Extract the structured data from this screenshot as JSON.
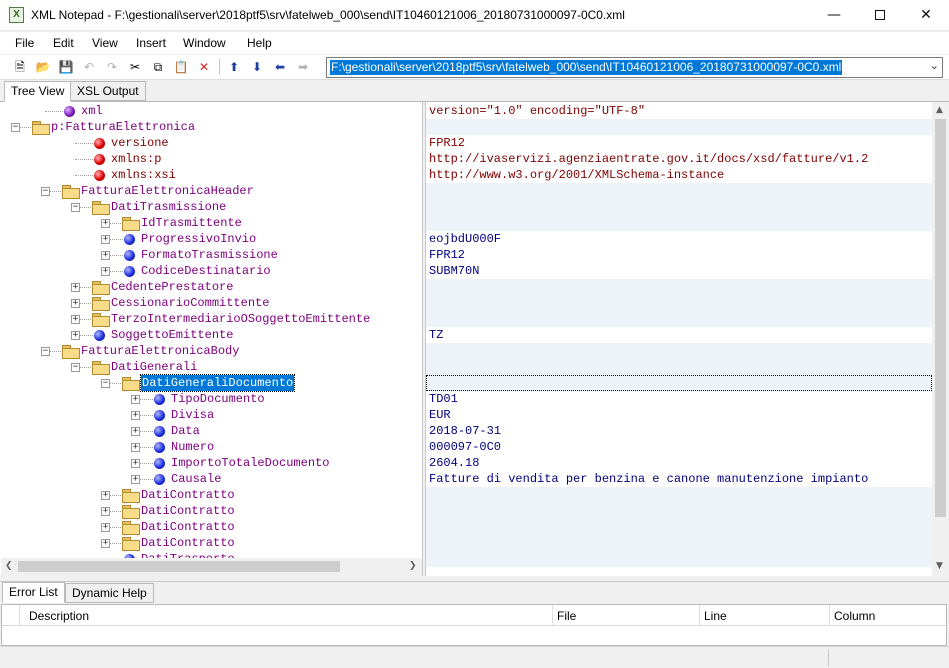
{
  "window": {
    "title": "XML Notepad - F:\\gestionali\\server\\2018ptf5\\srv\\fatelweb_000\\send\\IT10460121006_20180731000097-0C0.xml",
    "app_icon_letter": "X"
  },
  "menu": [
    "File",
    "Edit",
    "View",
    "Insert",
    "Window",
    "Help"
  ],
  "toolbar": {
    "buttons": [
      "new-icon",
      "open-icon",
      "save-icon",
      "undo-icon",
      "redo-icon",
      "cut-icon",
      "copy-icon",
      "paste-icon",
      "delete-icon",
      "nudge-up-icon",
      "nudge-down-icon",
      "nudge-left-icon",
      "nudge-right-icon"
    ],
    "path": "F:\\gestionali\\server\\2018ptf5\\srv\\fatelweb_000\\send\\IT10460121006_20180731000097-0C0.xml"
  },
  "tabs": [
    "Tree View",
    "XSL Output"
  ],
  "tree": [
    {
      "label": "xml",
      "kind": "purple",
      "depth": 1,
      "expander": "",
      "value": "version=\"1.0\" encoding=\"UTF-8\""
    },
    {
      "label": "p:FatturaElettronica",
      "kind": "folder",
      "depth": 0,
      "expander": "−",
      "value": ""
    },
    {
      "label": "versione",
      "kind": "red",
      "depth": 2,
      "expander": "",
      "value": "FPR12"
    },
    {
      "label": "xmlns:p",
      "kind": "red",
      "depth": 2,
      "expander": "",
      "value": "http://ivaservizi.agenziaentrate.gov.it/docs/xsd/fatture/v1.2"
    },
    {
      "label": "xmlns:xsi",
      "kind": "red",
      "depth": 2,
      "expander": "",
      "value": "http://www.w3.org/2001/XMLSchema-instance"
    },
    {
      "label": "FatturaElettronicaHeader",
      "kind": "folder",
      "depth": 1,
      "expander": "−",
      "value": ""
    },
    {
      "label": "DatiTrasmissione",
      "kind": "folder",
      "depth": 2,
      "expander": "−",
      "value": ""
    },
    {
      "label": "IdTrasmittente",
      "kind": "folder",
      "depth": 3,
      "expander": "+",
      "value": ""
    },
    {
      "label": "ProgressivoInvio",
      "kind": "blue",
      "depth": 3,
      "expander": "+",
      "value": "eojbdU000F"
    },
    {
      "label": "FormatoTrasmissione",
      "kind": "blue",
      "depth": 3,
      "expander": "+",
      "value": "FPR12"
    },
    {
      "label": "CodiceDestinatario",
      "kind": "blue",
      "depth": 3,
      "expander": "+",
      "value": "SUBM70N"
    },
    {
      "label": "CedentePrestatore",
      "kind": "folder",
      "depth": 2,
      "expander": "+",
      "value": ""
    },
    {
      "label": "CessionarioCommittente",
      "kind": "folder",
      "depth": 2,
      "expander": "+",
      "value": ""
    },
    {
      "label": "TerzoIntermediarioOSoggettoEmittente",
      "kind": "folder",
      "depth": 2,
      "expander": "+",
      "value": ""
    },
    {
      "label": "SoggettoEmittente",
      "kind": "blue",
      "depth": 2,
      "expander": "+",
      "value": "TZ"
    },
    {
      "label": "FatturaElettronicaBody",
      "kind": "folder",
      "depth": 1,
      "expander": "−",
      "value": ""
    },
    {
      "label": "DatiGenerali",
      "kind": "folder",
      "depth": 2,
      "expander": "−",
      "value": ""
    },
    {
      "label": "DatiGeneraliDocumento",
      "kind": "folder",
      "depth": 3,
      "expander": "−",
      "value": "",
      "selected": true
    },
    {
      "label": "TipoDocumento",
      "kind": "blue",
      "depth": 4,
      "expander": "+",
      "value": "TD01"
    },
    {
      "label": "Divisa",
      "kind": "blue",
      "depth": 4,
      "expander": "+",
      "value": "EUR"
    },
    {
      "label": "Data",
      "kind": "blue",
      "depth": 4,
      "expander": "+",
      "value": "2018-07-31"
    },
    {
      "label": "Numero",
      "kind": "blue",
      "depth": 4,
      "expander": "+",
      "value": "000097-0C0"
    },
    {
      "label": "ImportoTotaleDocumento",
      "kind": "blue",
      "depth": 4,
      "expander": "+",
      "value": "2604.18"
    },
    {
      "label": "Causale",
      "kind": "blue",
      "depth": 4,
      "expander": "+",
      "value": "Fatture di vendita per benzina e canone manutenzione impianto"
    },
    {
      "label": "DatiContratto",
      "kind": "folder",
      "depth": 3,
      "expander": "+",
      "value": ""
    },
    {
      "label": "DatiContratto",
      "kind": "folder",
      "depth": 3,
      "expander": "+",
      "value": ""
    },
    {
      "label": "DatiContratto",
      "kind": "folder",
      "depth": 3,
      "expander": "+",
      "value": ""
    },
    {
      "label": "DatiContratto",
      "kind": "folder",
      "depth": 3,
      "expander": "+",
      "value": ""
    },
    {
      "label": "DatiTrasporto",
      "kind": "blue",
      "depth": 3,
      "expander": "",
      "value": ""
    }
  ],
  "bottom_tabs": [
    "Error List",
    "Dynamic Help"
  ],
  "error_columns": [
    "Description",
    "File",
    "Line",
    "Column"
  ]
}
